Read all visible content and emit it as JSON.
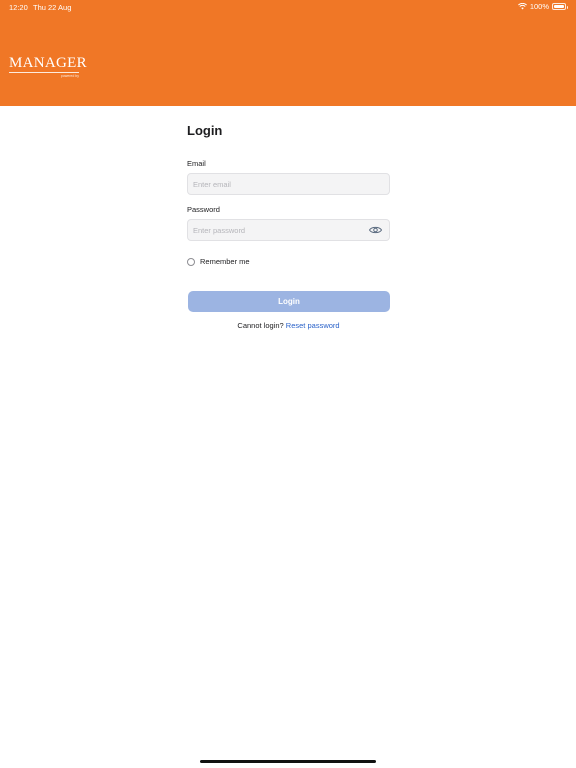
{
  "status_bar": {
    "time": "12:20",
    "date": "Thu 22 Aug",
    "battery": "100%",
    "battery_level": 1.0
  },
  "header": {
    "logo_text": "MANAGER",
    "logo_subtext": "powered by",
    "color": "#f07726"
  },
  "form": {
    "title": "Login",
    "email_label": "Email",
    "email_placeholder": "Enter email",
    "email_value": "",
    "password_label": "Password",
    "password_placeholder": "Enter password",
    "password_value": "",
    "remember_label": "Remember me",
    "remember_checked": false,
    "login_button": "Login",
    "cannot_login": "Cannot login?",
    "reset_link": "Reset password"
  },
  "icons": {
    "password_toggle": "eye-icon",
    "wifi": "wifi-icon",
    "battery": "battery-icon"
  },
  "colors": {
    "accent": "#f07726",
    "button_disabled": "#9cb4e2",
    "link": "#2a62c9"
  }
}
